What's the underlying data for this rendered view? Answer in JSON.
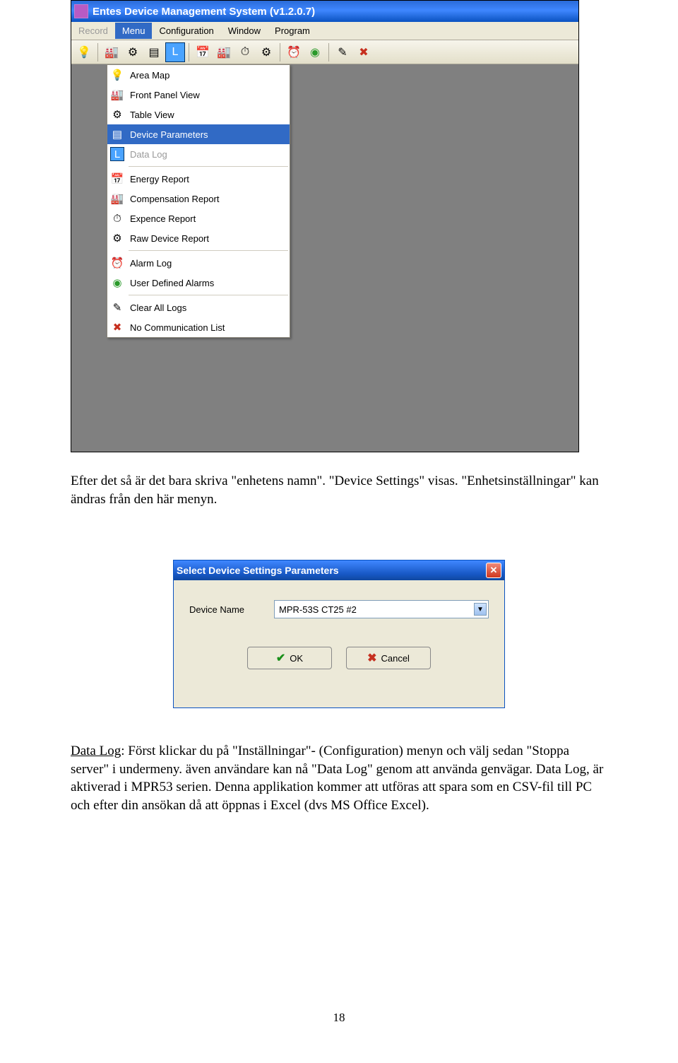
{
  "window": {
    "title": "Entes Device Management System  (v1.2.0.7)",
    "menubar": {
      "record": "Record",
      "menu": "Menu",
      "configuration": "Configuration",
      "window": "Window",
      "program": "Program"
    },
    "toolbar_icons": {
      "bulb": "💡",
      "panel": "🏭",
      "gear": "⚙",
      "params": "▤",
      "log": "L",
      "calendar": "📅",
      "panel2": "🏭",
      "clock": "⏱",
      "gear2": "⚙",
      "sep": "",
      "alarm": "⏰",
      "green": "◉",
      "sep2": "",
      "brush": "✎",
      "redx": "✖"
    },
    "menu_items": {
      "area_map": "Area Map",
      "front_panel": "Front Panel View",
      "table_view": "Table View",
      "device_params": "Device Parameters",
      "data_log": "Data Log",
      "energy_report": "Energy Report",
      "compensation_report": "Compensation Report",
      "expence_report": "Expence Report",
      "raw_device_report": "Raw Device Report",
      "alarm_log": "Alarm Log",
      "user_defined_alarms": "User Defined Alarms",
      "clear_all_logs": "Clear All Logs",
      "no_comm_list": "No Communication List"
    },
    "menu_icons": {
      "area_map": "💡",
      "front_panel": "🏭",
      "table_view": "⚙",
      "device_params": "▤",
      "data_log": "L",
      "energy_report": "📅",
      "compensation_report": "🏭",
      "expence_report": "⏱",
      "raw_device_report": "⚙",
      "alarm_log": "⏰",
      "user_defined_alarms": "◉",
      "clear_all_logs": "✎",
      "no_comm_list": "✖"
    }
  },
  "paragraph1": "Efter det så är det bara skriva \"enhetens namn\". \"Device Settings\" visas. \"Enhetsinställningar\" kan ändras från den här menyn.",
  "dialog": {
    "title": "Select Device Settings Parameters",
    "field_label": "Device Name",
    "field_value": "MPR-53S CT25 #2",
    "ok": "OK",
    "cancel": "Cancel"
  },
  "paragraph2_a": "Data Log",
  "paragraph2_b": ": Först klickar du på \"Inställningar\"- (Configuration) menyn och välj sedan \"Stoppa server\" i undermeny. även användare kan nå \"Data Log\" genom att använda genvägar. Data Log, är aktiverad i MPR53 serien. Denna applikation kommer att utföras att spara som en CSV-fil till PC och efter din  ansökan då att öppnas i Excel (dvs MS Office Excel).",
  "page_number": "18"
}
